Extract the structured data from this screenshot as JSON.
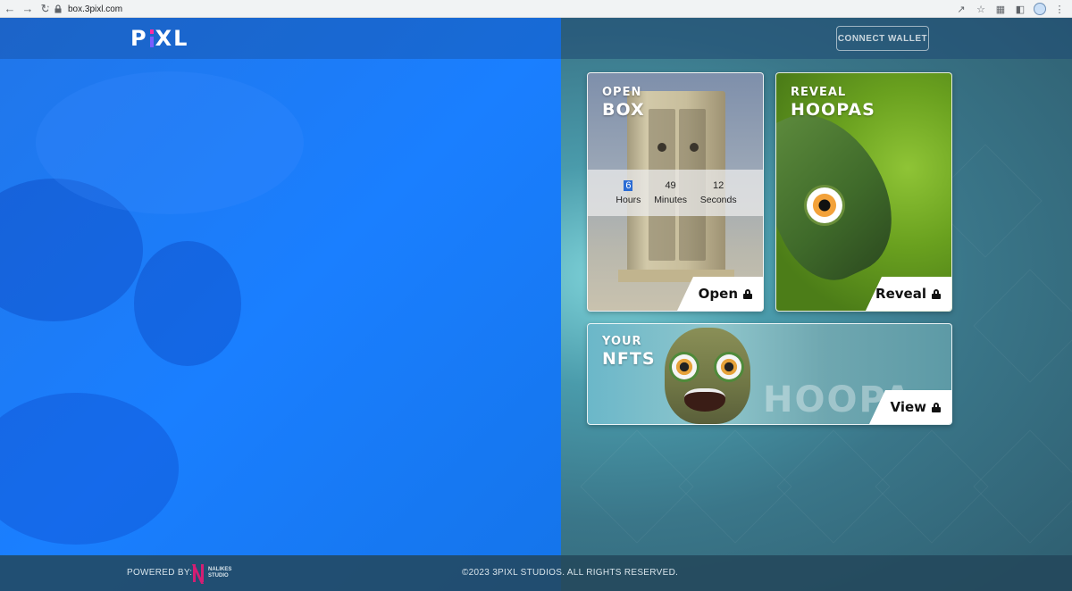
{
  "browser": {
    "url": "box.3pixl.com",
    "icons": [
      "back-icon",
      "forward-icon",
      "reload-icon",
      "lock-icon",
      "share-icon",
      "star-icon",
      "extensions-icon",
      "sidebar-icon",
      "profile-icon",
      "menu-icon"
    ]
  },
  "header": {
    "logo_text": "PXL",
    "connect_wallet_label": "CONNECT WALLET"
  },
  "cards": {
    "open_box": {
      "title_small": "OPEN",
      "title_big": "BOX",
      "action_label": "Open",
      "countdown": {
        "hours_value": "6",
        "hours_label": "Hours",
        "minutes_value": "49",
        "minutes_label": "Minutes",
        "seconds_value": "12",
        "seconds_label": "Seconds"
      }
    },
    "reveal_hoopas": {
      "title_small": "REVEAL",
      "title_big": "HOOPAS",
      "action_label": "Reveal"
    },
    "your_nfts": {
      "title_small": "YOUR",
      "title_big": "NFTS",
      "action_label": "View",
      "art_text": "HOOPA"
    }
  },
  "footer": {
    "powered_by": "POWERED BY:",
    "studio_name_line1": "NALIKES",
    "studio_name_line2": "STUDIO",
    "copyright": "©2023 3PIXL STUDIOS. ALL RIGHTS RESERVED."
  },
  "colors": {
    "left_panel": "#1a7fff",
    "right_panel": "#3a7689",
    "accent_pink": "#ff2aa0",
    "accent_purple": "#7a5cff",
    "studio_pink": "#d41e73"
  }
}
